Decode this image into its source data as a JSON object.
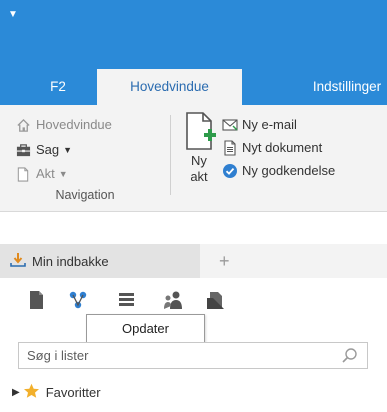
{
  "window": {
    "quick_access_icon": "dropdown-arrow-icon"
  },
  "tabs": [
    {
      "label": "F2"
    },
    {
      "label": "Hovedvindue"
    },
    {
      "label": "Indstillinger"
    }
  ],
  "navigation": {
    "items": [
      {
        "label": "Hovedvindue",
        "icon": "home-icon"
      },
      {
        "label": "Sag",
        "icon": "case-icon"
      },
      {
        "label": "Akt",
        "icon": "document-icon"
      }
    ],
    "group_label": "Navigation"
  },
  "new_akt": {
    "label_line1": "Ny",
    "label_line2": "akt"
  },
  "new_items": [
    {
      "label": "Ny e-mail",
      "icon": "email-icon"
    },
    {
      "label": "Nyt dokument",
      "icon": "new-document-icon"
    },
    {
      "label": "Ny godkendelse",
      "icon": "approval-icon"
    }
  ],
  "inbox": {
    "tab_label": "Min indbakke",
    "add_tab": "+"
  },
  "toolbar": {
    "tooltip": "Opdater"
  },
  "search": {
    "placeholder": "Søg i lister"
  },
  "tree": {
    "favorites_label": "Favoritter"
  },
  "colors": {
    "accent": "#2b8ad8",
    "ribbon_bg": "#f3f3f3",
    "star": "#f2b02c",
    "green": "#2e9b4a"
  }
}
